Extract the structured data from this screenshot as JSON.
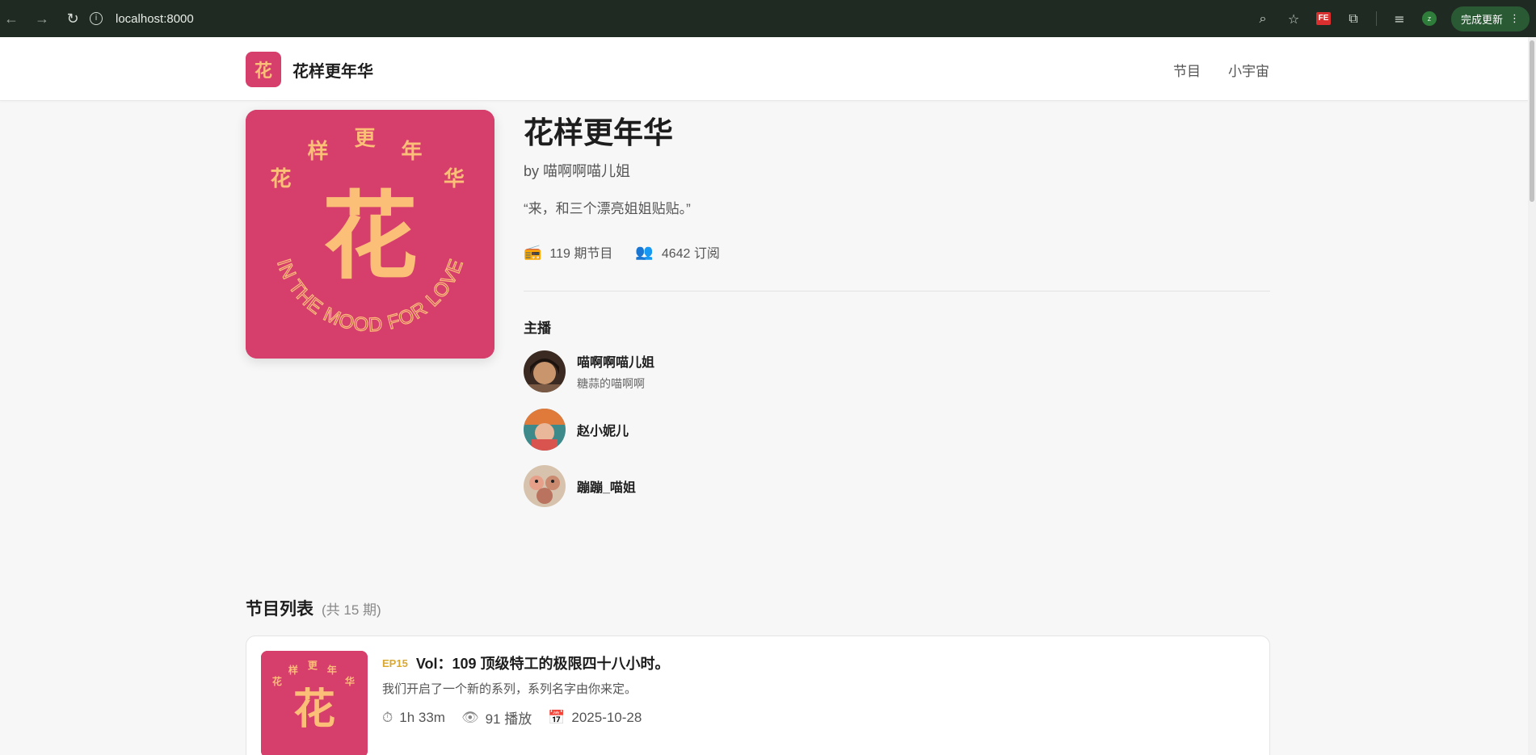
{
  "browser": {
    "url": "localhost:8000",
    "update_label": "完成更新"
  },
  "site": {
    "logo_char": "花",
    "name": "花样更年华",
    "nav": [
      "节目",
      "小宇宙"
    ]
  },
  "podcast": {
    "cover_chars": [
      "花",
      "样",
      "更",
      "年",
      "华"
    ],
    "cover_big_char": "花",
    "cover_ring_text": "IN THE MOOD FOR LOVE",
    "title": "花样更年华",
    "author": "by 喵啊啊喵儿姐",
    "tagline": "“来，和三个漂亮姐姐贴贴。”",
    "episode_count": "119 期节目",
    "subscribers": "4642 订阅"
  },
  "hosts": {
    "heading": "主播",
    "items": [
      {
        "name": "喵啊啊喵儿姐",
        "subtitle": "糖蒜的喵啊啊"
      },
      {
        "name": "赵小妮儿",
        "subtitle": ""
      },
      {
        "name": "蹦蹦_喵姐",
        "subtitle": ""
      }
    ]
  },
  "episodes": {
    "heading": "节目列表",
    "count_label": "(共 15 期)",
    "items": [
      {
        "code": "EP15",
        "title": "Vol：109 顶级特工的极限四十八小时。",
        "description": "我们开启了一个新的系列，系列名字由你来定。",
        "duration": "1h 33m",
        "plays": "91 播放",
        "date": "2025-10-28"
      }
    ]
  },
  "colors": {
    "cover_bg": "#d63e6c",
    "cover_fg": "#fbbf78",
    "ep_code": "#d9a830"
  },
  "icons": {
    "episodes": "radio-icon",
    "subscribers": "people-icon",
    "duration": "clock-icon",
    "plays": "eye-icon",
    "date": "calendar-icon"
  }
}
